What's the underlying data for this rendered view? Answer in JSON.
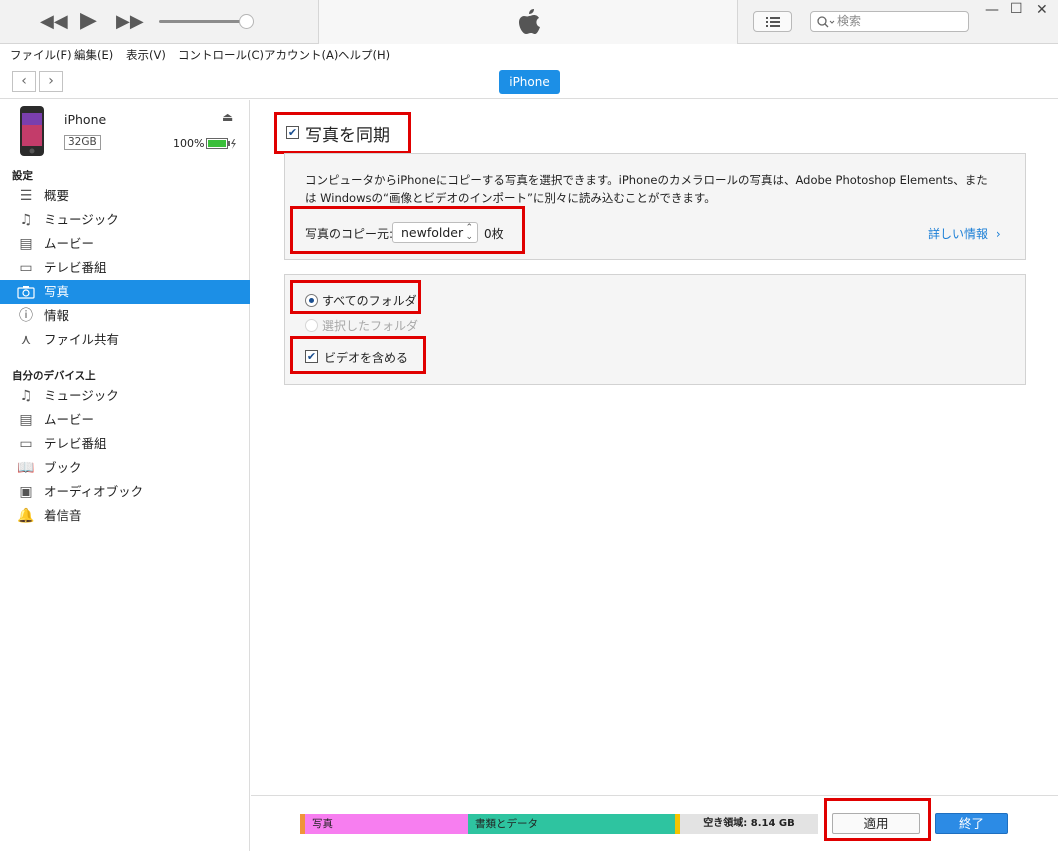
{
  "search": {
    "placeholder": "検索"
  },
  "menubar": {
    "items": [
      "ファイル(F)",
      "編集(E)",
      "表示(V)",
      "コントロール(C)",
      "アカウント(A)",
      "ヘルプ(H)"
    ]
  },
  "nav": {
    "device_tab": "iPhone"
  },
  "device": {
    "name": "iPhone",
    "capacity": "32GB",
    "battery": "100%"
  },
  "sidebar": {
    "settings_header": "設定",
    "settings_items": [
      "概要",
      "ミュージック",
      "ムービー",
      "テレビ番組",
      "写真",
      "情報",
      "ファイル共有"
    ],
    "selected": "写真",
    "ondevice_header": "自分のデバイス上",
    "ondevice_items": [
      "ミュージック",
      "ムービー",
      "テレビ番組",
      "ブック",
      "オーディオブック",
      "着信音"
    ]
  },
  "main": {
    "sync_label": "写真を同期",
    "sync_checked": true,
    "desc_line1": "コンピュータからiPhoneにコピーする写真を選択できます。iPhoneのカメラロールの写真は、Adobe Photoshop Elements、また",
    "desc_line2": "は Windowsの“画像とビデオのインポート”に別々に読み込むことができます。",
    "copy_from_label": "写真のコピー元:",
    "copy_from_value": "newfolder",
    "count": "0枚",
    "more_info": "詳しい情報",
    "opt_all_folders": "すべてのフォルダ",
    "opt_selected_folders": "選択したフォルダ",
    "opt_include_videos": "ビデオを含める",
    "all_folders_selected": true,
    "include_videos_checked": true
  },
  "storage": {
    "segments": [
      {
        "label": "写真",
        "color": "#f77ef0"
      },
      {
        "label": "書類とデータ",
        "color": "#2ec4a0"
      },
      {
        "label": "空き領域: 8.14 GB",
        "color": "#e3e3e3"
      }
    ],
    "apply_label": "適用",
    "done_label": "終了"
  },
  "colors": {
    "accent": "#1c8fe6",
    "highlight": "#e00000"
  }
}
